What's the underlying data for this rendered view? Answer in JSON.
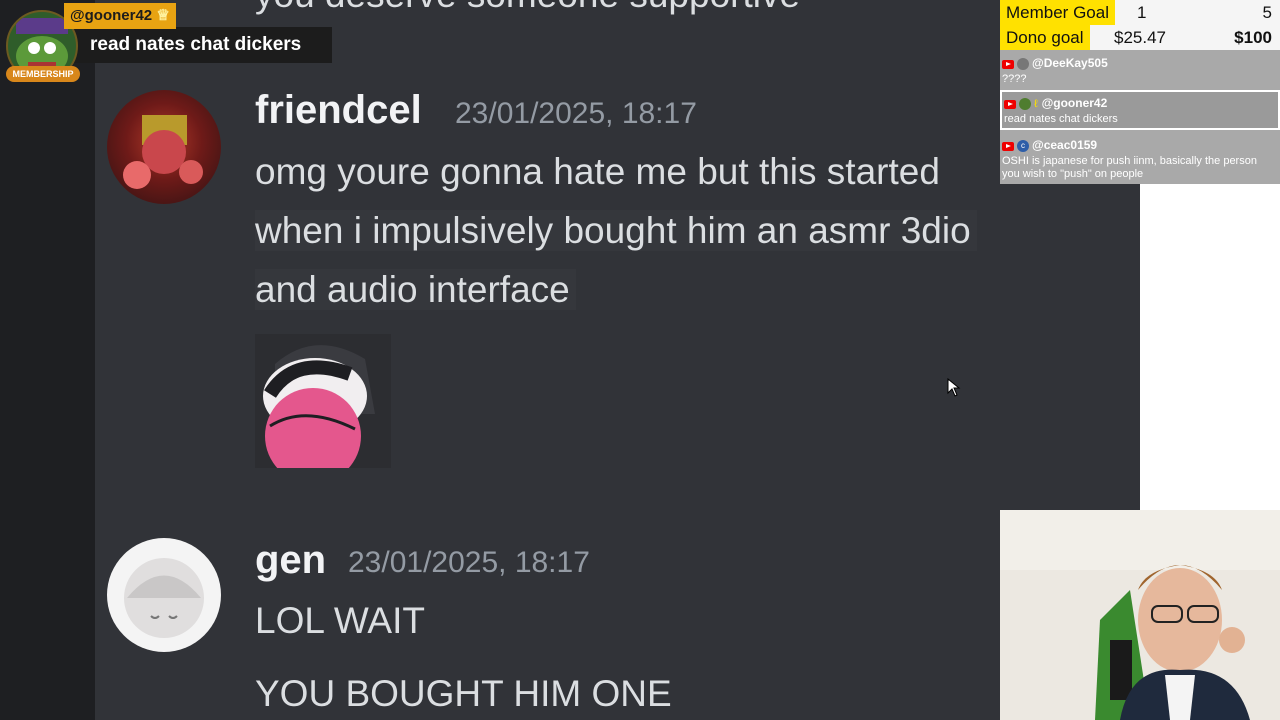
{
  "alert": {
    "username": "@gooner42",
    "message": "read nates chat dickers",
    "badge": "MEMBERSHIP"
  },
  "discord": {
    "top_cut_text": "you deserve someone supportive",
    "messages": [
      {
        "author": "friendcel",
        "timestamp": "23/01/2025, 18:17",
        "lines": [
          "omg youre gonna hate me but this started",
          "when i impulsively bought him an asmr 3dio",
          "and audio interface"
        ]
      },
      {
        "author": "gen",
        "timestamp": "23/01/2025, 18:17",
        "lines": [
          "LOL WAIT",
          "YOU BOUGHT HIM ONE"
        ]
      }
    ]
  },
  "goals": {
    "member": {
      "label": "Member Goal",
      "current": "1",
      "target": "5",
      "progress": 0.2
    },
    "dono": {
      "label": "Dono goal",
      "current": "$25.47",
      "target": "$100",
      "progress": 0.25
    }
  },
  "chat": [
    {
      "user": "@DeeKay505",
      "text": "????"
    },
    {
      "user": "@gooner42",
      "text": "read nates chat dickers"
    },
    {
      "user": "@ceac0159",
      "text": "OSHI is japanese for push iinm, basically the person you wish to \"push\" on people"
    }
  ],
  "colors": {
    "youtube": "#ff0000",
    "goal_yellow": "#ffe100",
    "discord_bg": "#313338"
  }
}
